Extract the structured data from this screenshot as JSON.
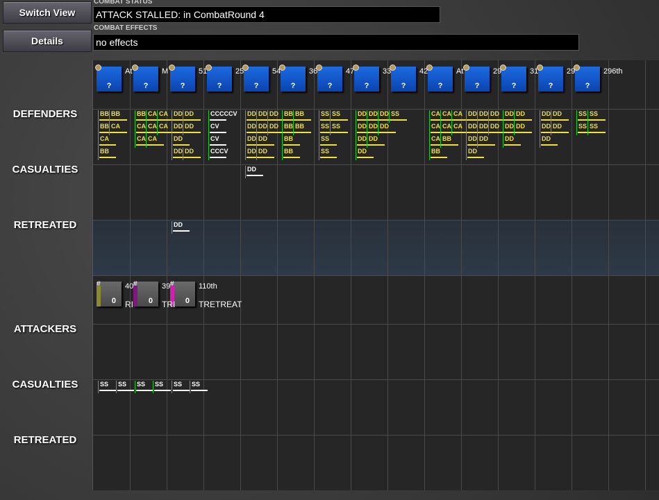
{
  "buttons": {
    "switch_view": "Switch View",
    "details": "Details"
  },
  "status": {
    "label": "COMBAT STATUS",
    "value": "ATTACK STALLED: in CombatRound  4"
  },
  "effects": {
    "label": "COMBAT EFFECTS",
    "value": "no effects"
  },
  "row_labels": {
    "defenders": "DEFENDERS",
    "def_casualties": "CASUALTIES",
    "def_retreated": "RETREATED",
    "attackers": "ATTACKERS",
    "att_casualties": "CASUALTIES",
    "att_retreated": "RETREATED"
  },
  "defender_units": [
    {
      "label": "At"
    },
    {
      "label": "M"
    },
    {
      "label": "51"
    },
    {
      "label": "25"
    },
    {
      "label": "54"
    },
    {
      "label": "36"
    },
    {
      "label": "47"
    },
    {
      "label": "33"
    },
    {
      "label": "42"
    },
    {
      "label": "At"
    },
    {
      "label": "29"
    },
    {
      "label": "31"
    },
    {
      "label": "29"
    },
    {
      "label": "296th"
    }
  ],
  "unit_mark": "?",
  "defender_ships": [
    [
      [
        "BB",
        "BB"
      ],
      [
        "BB",
        "CA"
      ],
      [
        "CA"
      ],
      [
        "BB"
      ]
    ],
    [
      [
        "BB",
        "CA",
        "CA"
      ],
      [
        "CA",
        "CA",
        "CA"
      ],
      [
        "CA",
        "CA"
      ]
    ],
    [
      [
        "DD",
        "DD"
      ],
      [
        "DD",
        "DD"
      ],
      [
        "DD"
      ],
      [
        "DD",
        "DD"
      ]
    ],
    [
      [
        "CCCCCV"
      ],
      [
        "CV"
      ],
      [
        "CV"
      ],
      [
        "CCCV"
      ]
    ],
    [
      [
        "DD",
        "DD",
        "DD"
      ],
      [
        "DD",
        "DD",
        "DD"
      ],
      [
        "DD",
        "DD"
      ],
      [
        "DD",
        "DD"
      ]
    ],
    [
      [
        "BB",
        "BB"
      ],
      [
        "BB",
        "BB"
      ],
      [
        "BB"
      ],
      [
        "BB"
      ]
    ],
    [
      [
        "SS",
        "SS"
      ],
      [
        "SS",
        "SS"
      ],
      [
        "SS"
      ],
      [
        "SS"
      ]
    ],
    [
      [
        "DD",
        "DD",
        "DD",
        "SS"
      ],
      [
        "DD",
        "DD",
        "DD"
      ],
      [
        "DD",
        "DD"
      ],
      [
        "DD"
      ]
    ],
    [],
    [
      [
        "CA",
        "CA",
        "CA"
      ],
      [
        "CA",
        "CA",
        "CA"
      ],
      [
        "CA",
        "BB"
      ],
      [
        "BB"
      ]
    ],
    [
      [
        "DD",
        "DD",
        "DD"
      ],
      [
        "DD",
        "DD",
        "DD"
      ],
      [
        "DD",
        "DD"
      ],
      [
        "DD"
      ]
    ],
    [
      [
        "DD",
        "DD"
      ],
      [
        "DD",
        "DD"
      ],
      [
        "DD"
      ]
    ],
    [
      [
        "DD",
        "DD"
      ],
      [
        "DD",
        "DD"
      ],
      [
        "DD"
      ]
    ],
    [
      [
        "SS",
        "SS"
      ],
      [
        "SS",
        "SS"
      ]
    ]
  ],
  "defender_casualties": [
    {
      "col": 4,
      "ships": [
        "DD"
      ]
    }
  ],
  "defender_retreated": [
    {
      "col": 2,
      "ships": [
        "DD"
      ]
    }
  ],
  "attacker_units": [
    {
      "label": "40",
      "status": "RI",
      "color": "#8a8a30"
    },
    {
      "label": "39",
      "status": "TRI",
      "color": "#801880"
    },
    {
      "label": "110th",
      "status": "TRETREAT",
      "color": "#d020b0"
    }
  ],
  "attacker_value": "0",
  "attacker_casualties": [
    {
      "col": 0,
      "ships": [
        "SS",
        "SS"
      ]
    },
    {
      "col": 1,
      "ships": [
        "SS",
        "SS"
      ]
    },
    {
      "col": 2,
      "ships": [
        "SS",
        "SS"
      ]
    }
  ]
}
